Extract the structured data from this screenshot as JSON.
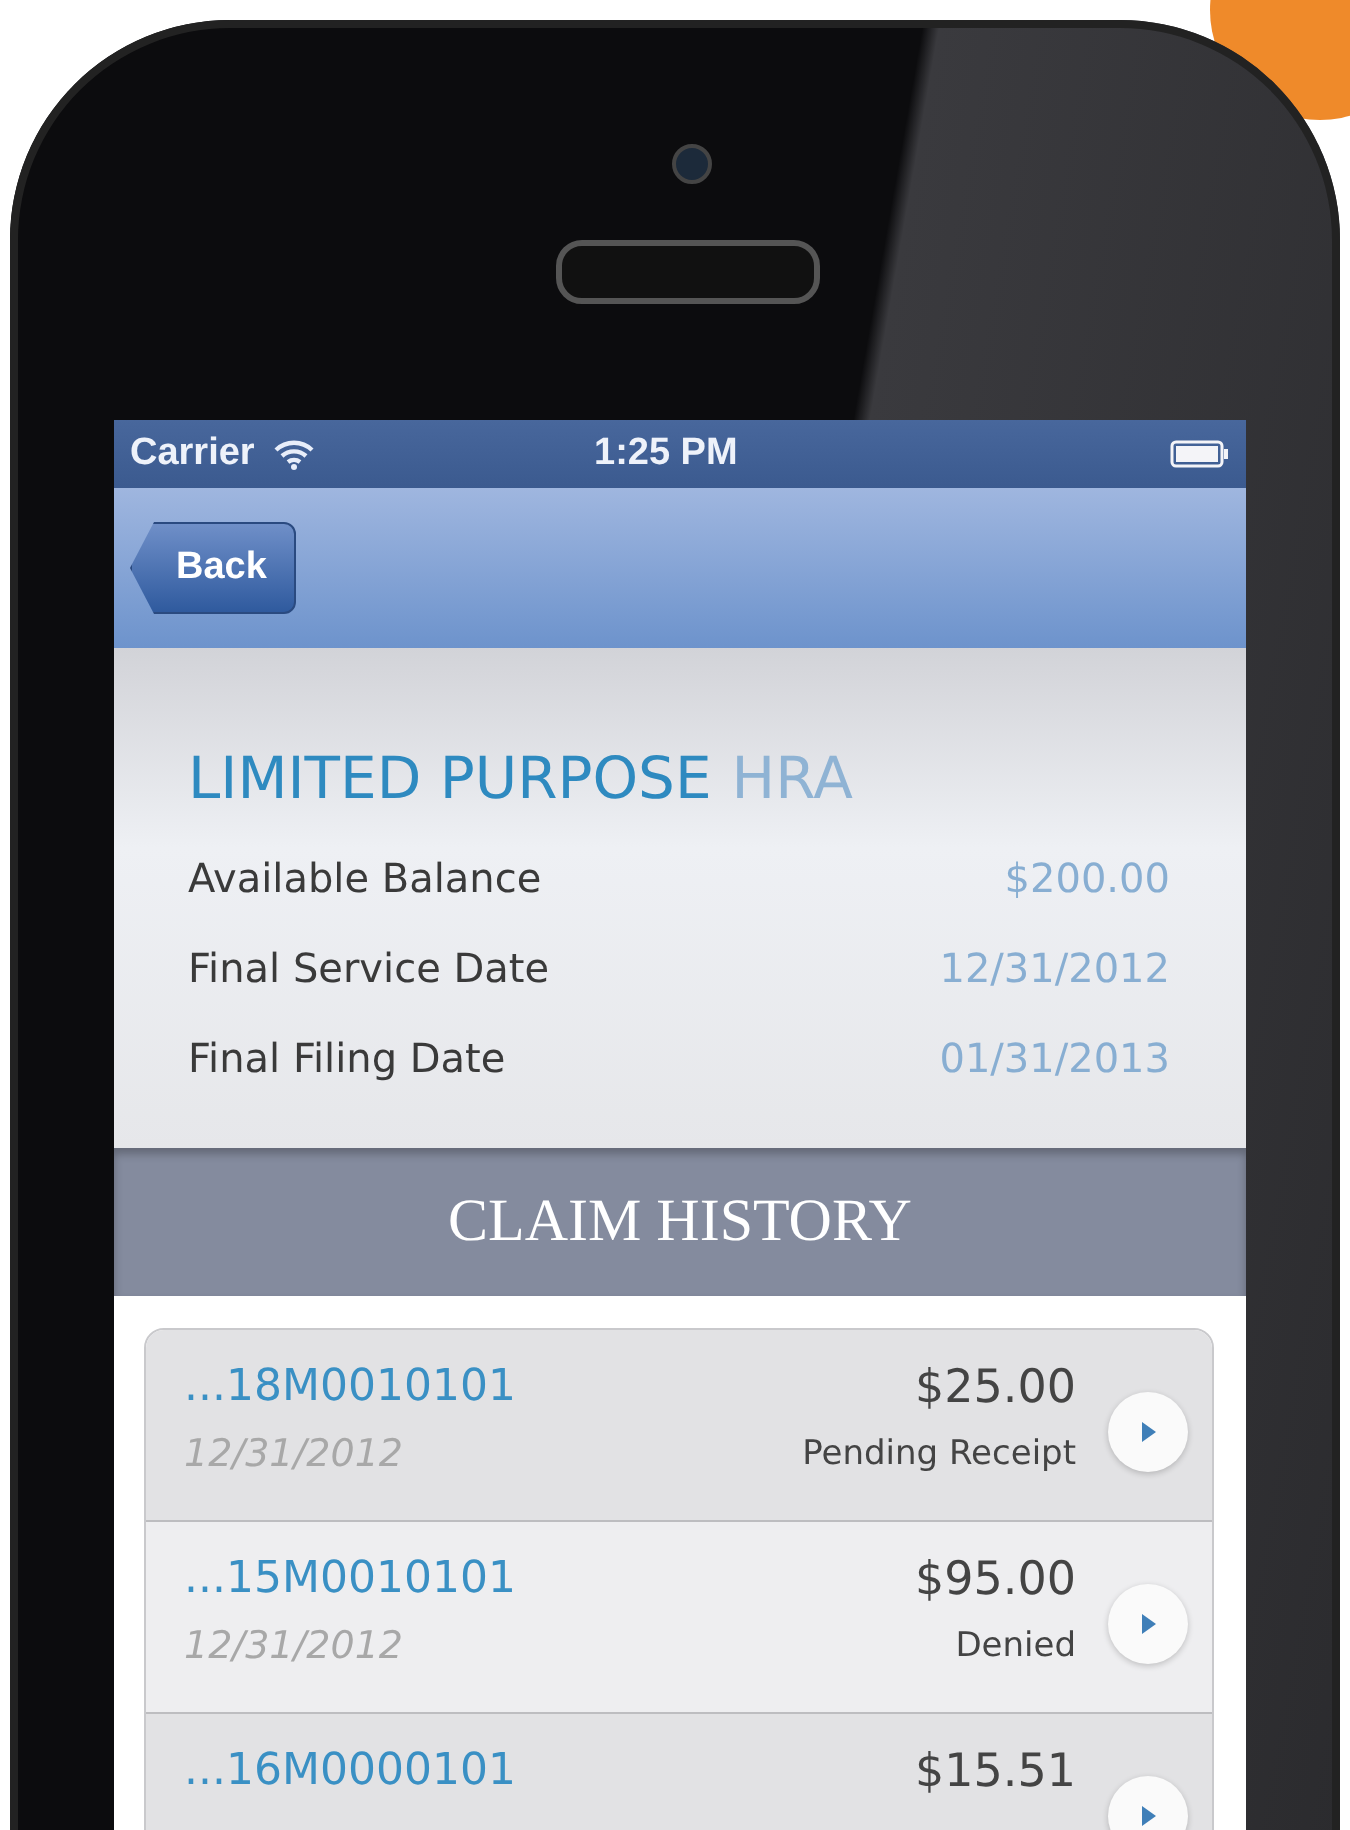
{
  "status_bar": {
    "carrier": "Carrier",
    "time": "1:25 PM"
  },
  "nav_bar": {
    "back_label": "Back"
  },
  "account": {
    "title": "LIMITED PURPOSE",
    "title_suffix": "HRA",
    "details": [
      {
        "label": "Available Balance",
        "value": "$200.00"
      },
      {
        "label": "Final Service Date",
        "value": "12/31/2012"
      },
      {
        "label": "Final Filing Date",
        "value": "01/31/2013"
      }
    ]
  },
  "claim_history": {
    "heading": "CLAIM HISTORY",
    "claims": [
      {
        "claim_id": "...18M0010101",
        "amount": "$25.00",
        "date": "12/31/2012",
        "status": "Pending Receipt"
      },
      {
        "claim_id": "...15M0010101",
        "amount": "$95.00",
        "date": "12/31/2012",
        "status": "Denied"
      },
      {
        "claim_id": "...16M0000101",
        "amount": "$15.51"
      }
    ]
  }
}
